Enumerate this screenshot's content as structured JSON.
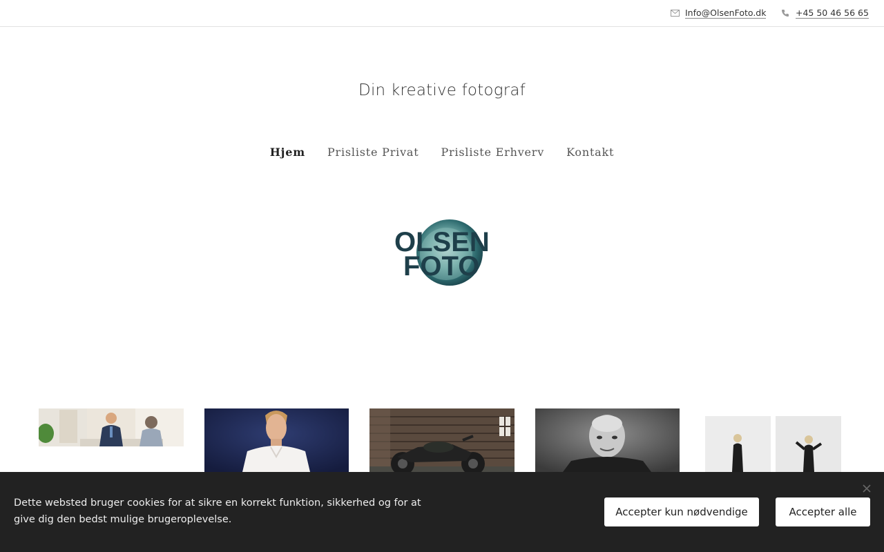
{
  "header": {
    "email": {
      "icon": "mail-icon",
      "text": "Info@OlsenFoto.dk"
    },
    "phone": {
      "icon": "phone-icon",
      "text": "+45 50 46 56 65"
    }
  },
  "tagline": "Din kreative fotograf",
  "nav": {
    "items": [
      {
        "label": "Hjem",
        "active": true
      },
      {
        "label": "Prisliste Privat",
        "active": false
      },
      {
        "label": "Prisliste Erhverv",
        "active": false
      },
      {
        "label": "Kontakt",
        "active": false
      }
    ]
  },
  "logo": {
    "line1": "OLSEN",
    "line2": "FOTO",
    "accent": "#2e6b6f",
    "text_color": "#1e3f4a"
  },
  "gallery": {
    "items": [
      {
        "name": "gallery-photo-business-meeting"
      },
      {
        "name": "gallery-photo-man-portrait-blue"
      },
      {
        "name": "gallery-photo-motorcycle"
      },
      {
        "name": "gallery-photo-man-portrait-bw"
      },
      {
        "name": "gallery-photo-woman-bw"
      }
    ]
  },
  "cookie": {
    "text": "Dette websted bruger cookies for at sikre en korrekt funktion, sikkerhed og for at give dig den bedst mulige brugeroplevelse.",
    "accept_necessary": "Accepter kun nødvendige",
    "accept_all": "Accepter alle",
    "close_icon": "close-icon",
    "background": "#222222"
  }
}
